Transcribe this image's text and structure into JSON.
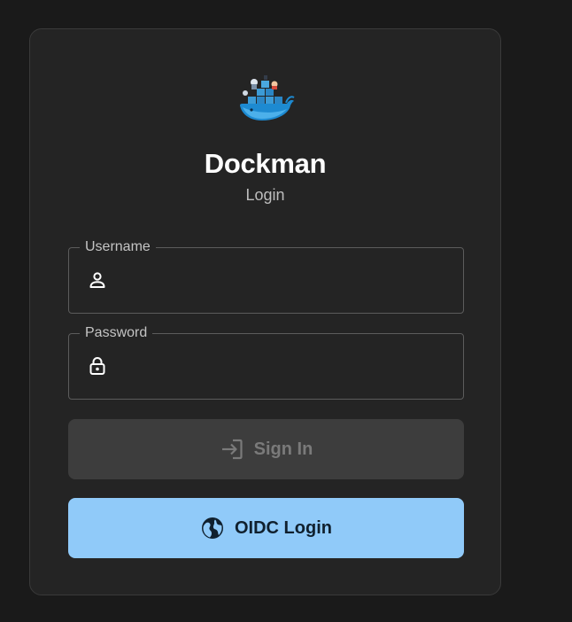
{
  "app": {
    "title": "Dockman",
    "subtitle": "Login"
  },
  "form": {
    "username": {
      "label": "Username",
      "value": "",
      "icon": "person-icon"
    },
    "password": {
      "label": "Password",
      "value": "",
      "icon": "lock-icon"
    },
    "signin": {
      "label": "Sign In",
      "icon": "login-icon",
      "disabled": true
    },
    "oidc": {
      "label": "OIDC Login",
      "icon": "globe-icon"
    }
  },
  "colors": {
    "background": "#1a1a1a",
    "card": "#242424",
    "accent": "#90caf9",
    "disabled_button": "#3d3d3d"
  }
}
